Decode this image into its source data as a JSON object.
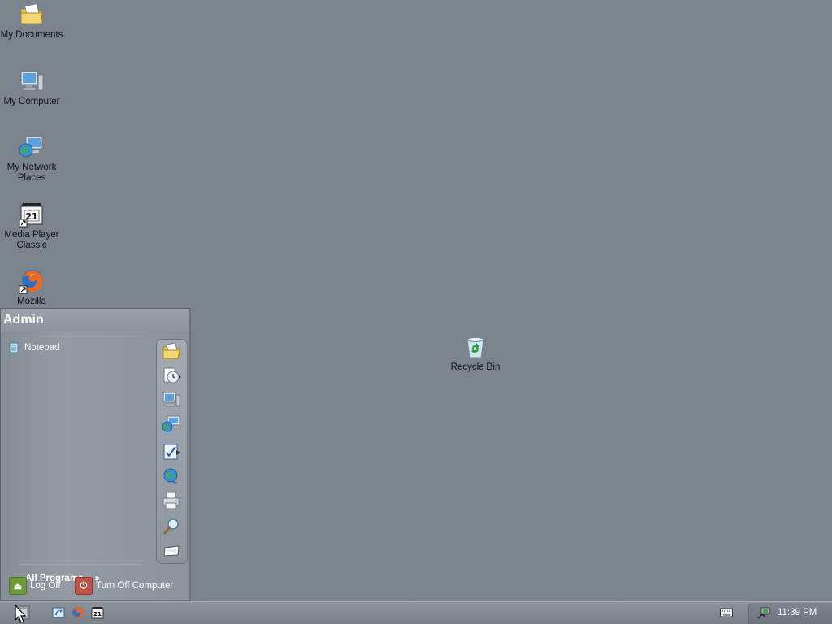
{
  "desktop": {
    "icons": [
      {
        "label": "My Documents",
        "icon": "folder-documents-icon"
      },
      {
        "label": "My Computer",
        "icon": "computer-icon"
      },
      {
        "label": "My Network Places",
        "icon": "network-places-icon"
      },
      {
        "label": "Media Player Classic",
        "icon": "media-player-icon"
      },
      {
        "label": "Mozilla",
        "icon": "firefox-icon"
      },
      {
        "label": "Recycle Bin",
        "icon": "recycle-bin-icon"
      }
    ]
  },
  "start_menu": {
    "user_name": "Admin",
    "pinned": [
      {
        "label": "Notepad",
        "icon": "notepad-icon"
      }
    ],
    "all_programs_label": "All Programs",
    "all_programs_arrow": "»",
    "right_icons": [
      "my-documents-icon",
      "recent-documents-icon",
      "my-computer-icon",
      "network-places-icon",
      "control-panel-icon",
      "internet-icon",
      "printers-icon",
      "search-icon",
      "run-icon"
    ],
    "log_off_label": "Log Off",
    "turn_off_label": "Turn Off Computer"
  },
  "taskbar": {
    "quick_launch": [
      "show-desktop-icon",
      "internet-explorer-icon",
      "firefox-icon",
      "media-player-icon"
    ],
    "tray_icons": [
      "keyboard-icon",
      "network-icon"
    ],
    "clock": "11:39 PM"
  },
  "colors": {
    "desktop": "#7b838d",
    "accent_logoff": "#6f9a3a",
    "accent_turnoff": "#c0524a"
  }
}
